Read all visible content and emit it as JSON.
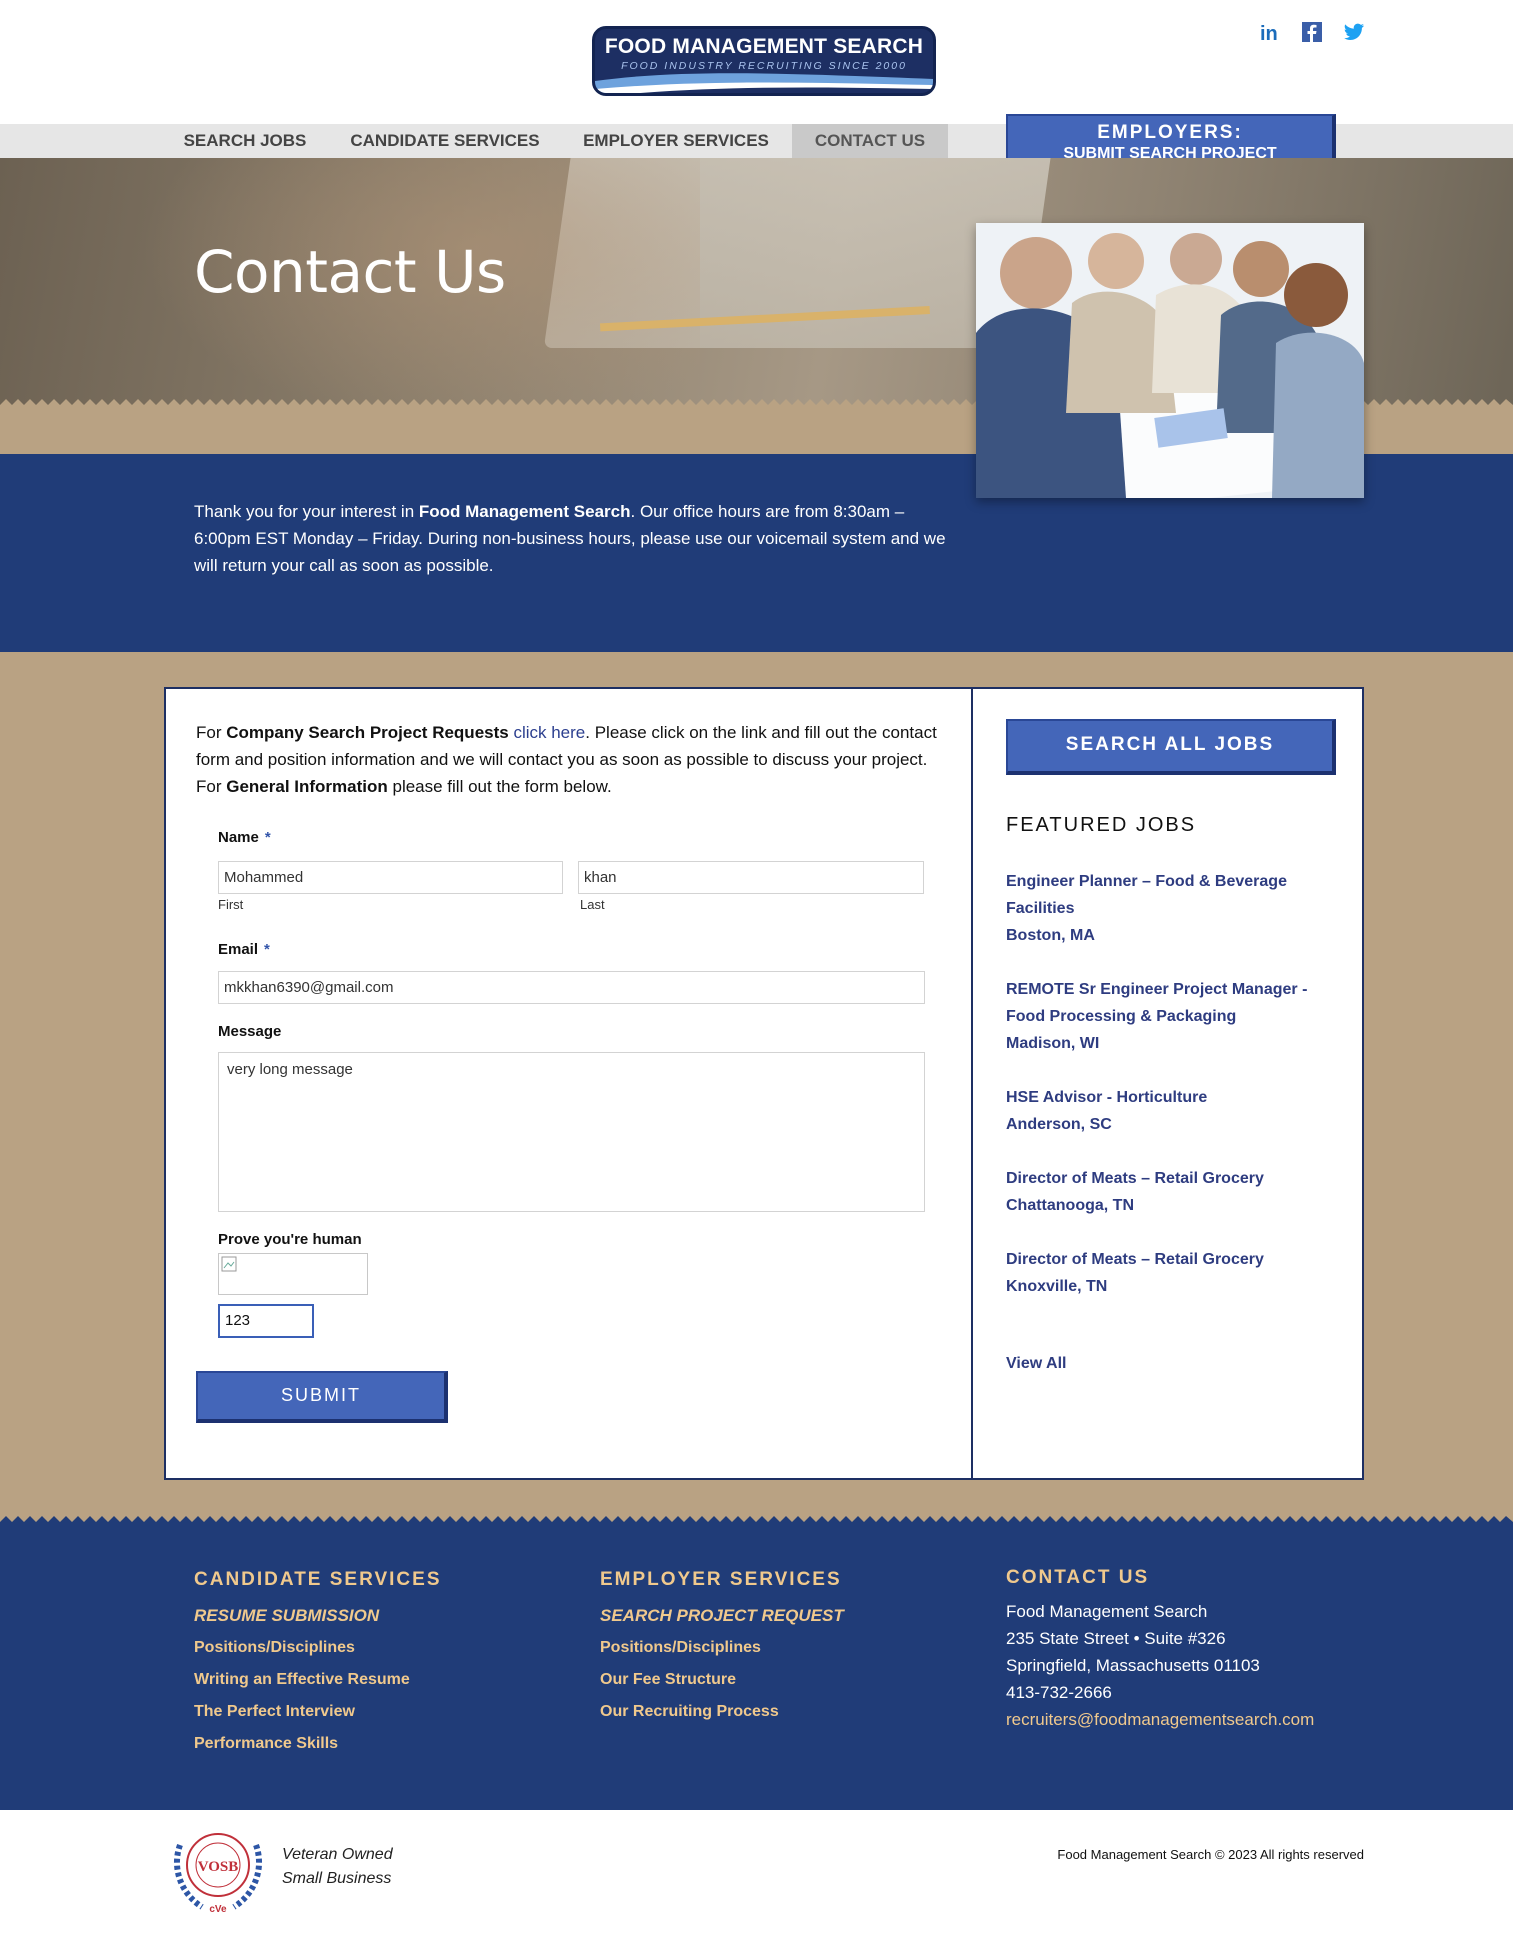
{
  "logo": {
    "title": "FOOD MANAGEMENT SEARCH",
    "subtitle": "FOOD INDUSTRY RECRUITING SINCE 2000"
  },
  "social": {
    "icons": [
      "linkedin-icon",
      "facebook-icon",
      "twitter-icon"
    ],
    "linkedin_label": "in"
  },
  "nav": {
    "items": [
      "SEARCH JOBS",
      "CANDIDATE SERVICES",
      "EMPLOYER SERVICES",
      "CONTACT US"
    ],
    "active": "CONTACT US"
  },
  "employers_button": {
    "line1": "EMPLOYERS:",
    "line2": "SUBMIT SEARCH PROJECT"
  },
  "hero": {
    "title": "Contact Us"
  },
  "intro": {
    "p1": "Thank you for your interest in ",
    "company": "Food Management Search",
    "p2": ". Our office hours are from 8:30am – 6:00pm EST Monday – Friday. During non-business hours, please use our voicemail system and we will return your call as soon as possible."
  },
  "form_intro": {
    "t1": "For ",
    "b1": "Company Search Project Requests",
    "link": "click here",
    "t2": ". Please click on the link and fill out the contact form and position information and we will contact you as soon as possible to discuss your project. For ",
    "b2": "General Information",
    "t3": " please fill out the form below."
  },
  "form": {
    "name_label": "Name",
    "required_mark": "*",
    "first_value": "Mohammed",
    "first_label": "First",
    "last_value": "khan",
    "last_label": "Last",
    "email_label": "Email",
    "email_value": "mkkhan6390@gmail.com",
    "message_label": "Message",
    "message_value": "very long message",
    "captcha_label": "Prove you're human",
    "captcha_value": "123",
    "submit_label": "SUBMIT"
  },
  "sidebar": {
    "search_button": "SEARCH ALL JOBS",
    "featured_title": "FEATURED JOBS",
    "jobs": [
      {
        "title": "Engineer Planner – Food & Beverage Facilities",
        "location": "Boston, MA"
      },
      {
        "title": "REMOTE Sr Engineer Project Manager - Food Processing & Packaging",
        "location": "Madison, WI"
      },
      {
        "title": "HSE Advisor - Horticulture",
        "location": "Anderson, SC"
      },
      {
        "title": "Director of Meats – Retail Grocery",
        "location": "Chattanooga, TN"
      },
      {
        "title": "Director of Meats – Retail Grocery",
        "location": "Knoxville, TN"
      }
    ],
    "view_all": "View All"
  },
  "footer": {
    "candidate": {
      "heading": "CANDIDATE SERVICES",
      "links": [
        "RESUME SUBMISSION",
        "Positions/Disciplines",
        "Writing an Effective Resume",
        "The Perfect Interview",
        "Performance Skills"
      ]
    },
    "employer": {
      "heading": "EMPLOYER SERVICES",
      "links": [
        "SEARCH PROJECT REQUEST",
        "Positions/Disciplines",
        "Our Fee Structure",
        "Our Recruiting Process"
      ]
    },
    "contact": {
      "heading": "CONTACT US",
      "name": "Food Management Search",
      "street": "235 State Street • Suite #326",
      "city": "Springfield, Massachusetts 01103",
      "phone": "413-732-2666",
      "email": "recruiters@foodmanagementsearch.com"
    }
  },
  "bottom": {
    "vosb_badge": "VOSB",
    "vosb_ring": "Veteran Owned Small Business",
    "vosb_mark": "cVe",
    "veteran_line1": "Veteran Owned",
    "veteran_line2": "Small Business",
    "copyright": "Food Management Search © 2023 All rights reserved"
  },
  "colors": {
    "navy": "#203c78",
    "button_blue": "#4466b9",
    "link_blue": "#2e3c80",
    "footer_gold": "#f0c98d",
    "sand": "#b9a283"
  }
}
